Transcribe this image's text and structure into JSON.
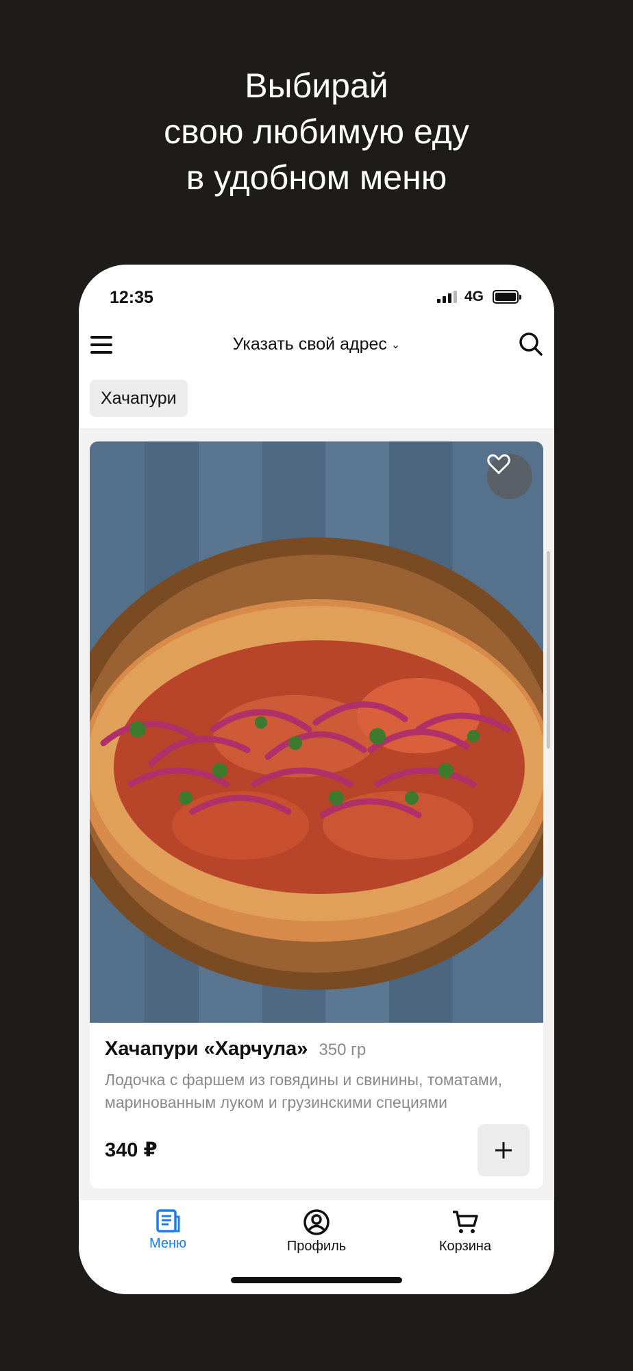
{
  "promo": {
    "line1": "Выбирай",
    "line2": "свою любимую еду",
    "line3": "в удобном меню"
  },
  "status": {
    "time": "12:35",
    "network": "4G"
  },
  "header": {
    "address_label": "Указать свой адрес"
  },
  "categories": {
    "active": "Хачапури"
  },
  "product": {
    "name": "Хачапури «Харчула»",
    "weight": "350 гр",
    "description": "Лодочка с фаршем из говядины и свинины, томатами, маринованным луком и грузинскими специями",
    "price": "340 ₽"
  },
  "tabs": {
    "menu": "Меню",
    "profile": "Профиль",
    "cart": "Корзина"
  },
  "colors": {
    "accent": "#1c7ce8",
    "background": "#1d1c1a"
  }
}
